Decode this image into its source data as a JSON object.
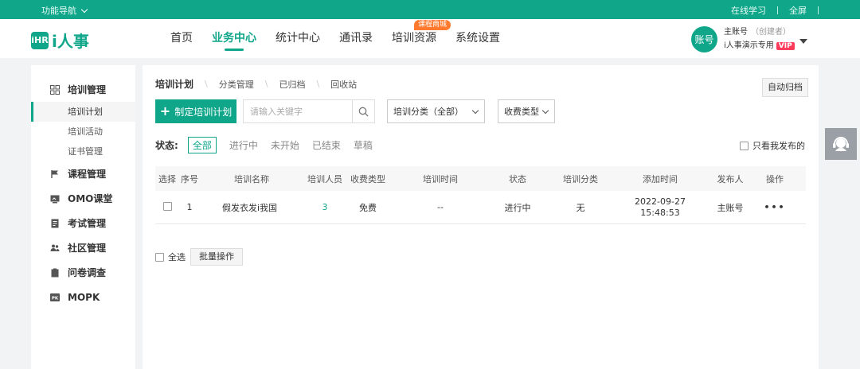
{
  "topbar": {
    "nav_toggle": "功能导航",
    "online_learning": "在线学习",
    "fullscreen": "全屏",
    "bg_color": "#0fa68a"
  },
  "logo": {
    "mark": "iHR",
    "text": "i人事"
  },
  "mainnav": {
    "items": [
      "首页",
      "业务中心",
      "统计中心",
      "通讯录",
      "培训资源",
      "系统设置"
    ],
    "active": "业务中心",
    "resource_badge": "课程商城"
  },
  "user": {
    "avatar": "账号",
    "name": "主账号",
    "role": "（创建者）",
    "company": "i人事演示专用",
    "vip": "VIP"
  },
  "sidebar": {
    "groups": [
      {
        "label": "培训管理",
        "icon": "grid-icon"
      },
      {
        "label": "课程管理",
        "icon": "flag-icon"
      },
      {
        "label": "OMO课堂",
        "icon": "classroom-icon"
      },
      {
        "label": "考试管理",
        "icon": "exam-icon"
      },
      {
        "label": "社区管理",
        "icon": "community-icon"
      },
      {
        "label": "问卷调查",
        "icon": "survey-icon"
      },
      {
        "label": "MOPK",
        "icon": "pk-icon"
      }
    ],
    "training_subitems": [
      "培训计划",
      "培训活动",
      "证书管理"
    ],
    "active_sub": "培训计划"
  },
  "tabs": {
    "items": [
      "培训计划",
      "分类管理",
      "已归档",
      "回收站"
    ],
    "active": "培训计划"
  },
  "auto_archive": "自动归档",
  "toolbar": {
    "create_label": "制定培训计划",
    "search_placeholder": "请输入关键字",
    "category_select": "培训分类（全部）",
    "fee_select": "收费类型"
  },
  "status_filter": {
    "label": "状态:",
    "options": [
      "全部",
      "进行中",
      "未开始",
      "已结束",
      "草稿"
    ],
    "active": "全部",
    "only_mine": "只看我发布的"
  },
  "table": {
    "headers": [
      "选择",
      "序号",
      "培训名称",
      "培训人员",
      "收费类型",
      "培训时间",
      "状态",
      "培训分类",
      "添加时间",
      "发布人",
      "操作"
    ],
    "rows": [
      {
        "no": "1",
        "name": "假发衣发i我国",
        "staff": "3",
        "fee": "免费",
        "time": "--",
        "status": "进行中",
        "category": "无",
        "date": "2022-09-27",
        "clock": "15:48:53",
        "publisher": "主账号",
        "ops": "•••"
      }
    ]
  },
  "footer": {
    "select_all": "全选",
    "batch": "批量操作"
  }
}
